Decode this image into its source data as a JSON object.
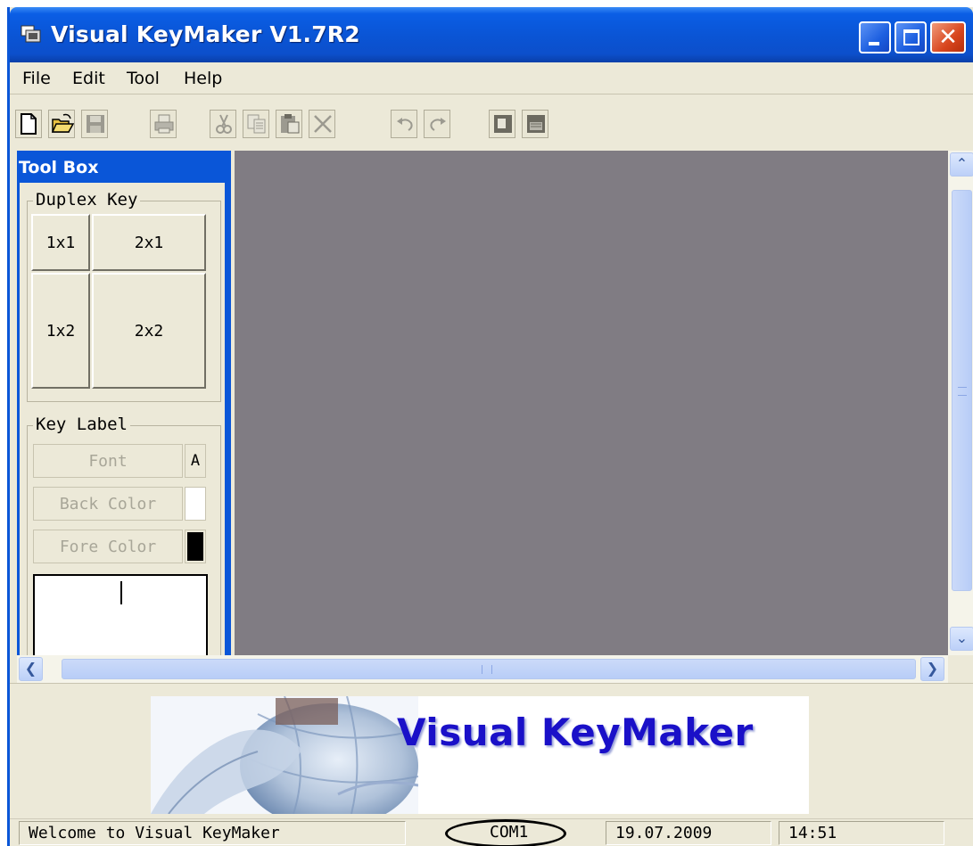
{
  "window": {
    "title": "Visual KeyMaker V1.7R2",
    "controls": [
      "minimize-icon",
      "maximize-icon",
      "close-icon"
    ],
    "close_glyph": "✕"
  },
  "menu": {
    "items": [
      "File",
      "Edit",
      "Tool",
      "Help"
    ]
  },
  "toolbar": {
    "buttons": [
      "new-icon",
      "open-icon",
      "save-icon",
      "print-icon",
      "cut-icon",
      "copy-icon",
      "paste-icon",
      "delete-icon",
      "undo-icon",
      "redo-icon",
      "key-view-icon",
      "key-print-icon"
    ]
  },
  "toolbox": {
    "title": "Tool Box",
    "duplex_group": {
      "label": "Duplex Key",
      "keys": [
        "1x1",
        "2x1",
        "1x2",
        "2x2"
      ]
    },
    "label_group": {
      "label": "Key Label",
      "font_button": "Font",
      "font_glyph": "A",
      "back_color_button": "Back Color",
      "fore_color_button": "Fore Color",
      "back_color": "#ffffff",
      "fore_color": "#000000"
    }
  },
  "scrollbars": {
    "up_arrow": "⌃",
    "down_arrow": "⌄",
    "left_arrow": "❮",
    "right_arrow": "❯"
  },
  "banner": {
    "text": "Visual KeyMaker"
  },
  "statusbar": {
    "message": "Welcome to Visual KeyMaker",
    "port": "COM1",
    "date": "19.07.2009",
    "time": "14:51"
  },
  "colors": {
    "titlebar_blue": "#0a55d6",
    "canvas_gray": "#807c83",
    "banner_text": "#1a10c8",
    "window_face": "#ece9d8"
  }
}
